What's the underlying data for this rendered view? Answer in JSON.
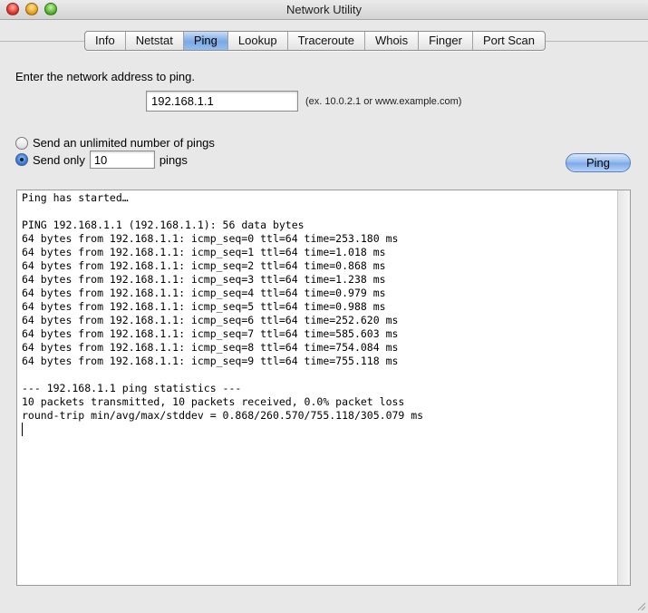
{
  "window": {
    "title": "Network Utility"
  },
  "tabs": [
    {
      "label": "Info",
      "active": false
    },
    {
      "label": "Netstat",
      "active": false
    },
    {
      "label": "Ping",
      "active": true
    },
    {
      "label": "Lookup",
      "active": false
    },
    {
      "label": "Traceroute",
      "active": false
    },
    {
      "label": "Whois",
      "active": false
    },
    {
      "label": "Finger",
      "active": false
    },
    {
      "label": "Port Scan",
      "active": false
    }
  ],
  "ping": {
    "prompt": "Enter the network address to ping.",
    "address_value": "192.168.1.1",
    "address_hint": "(ex. 10.0.2.1 or www.example.com)",
    "option_unlimited_label": "Send an unlimited number of pings",
    "option_limited_prefix": "Send only",
    "option_limited_value": "10",
    "option_limited_suffix": "pings",
    "selected_option": "limited",
    "button_label": "Ping"
  },
  "output": {
    "lines": [
      "Ping has started…",
      "",
      "PING 192.168.1.1 (192.168.1.1): 56 data bytes",
      "64 bytes from 192.168.1.1: icmp_seq=0 ttl=64 time=253.180 ms",
      "64 bytes from 192.168.1.1: icmp_seq=1 ttl=64 time=1.018 ms",
      "64 bytes from 192.168.1.1: icmp_seq=2 ttl=64 time=0.868 ms",
      "64 bytes from 192.168.1.1: icmp_seq=3 ttl=64 time=1.238 ms",
      "64 bytes from 192.168.1.1: icmp_seq=4 ttl=64 time=0.979 ms",
      "64 bytes from 192.168.1.1: icmp_seq=5 ttl=64 time=0.988 ms",
      "64 bytes from 192.168.1.1: icmp_seq=6 ttl=64 time=252.620 ms",
      "64 bytes from 192.168.1.1: icmp_seq=7 ttl=64 time=585.603 ms",
      "64 bytes from 192.168.1.1: icmp_seq=8 ttl=64 time=754.084 ms",
      "64 bytes from 192.168.1.1: icmp_seq=9 ttl=64 time=755.118 ms",
      "",
      "--- 192.168.1.1 ping statistics ---",
      "10 packets transmitted, 10 packets received, 0.0% packet loss",
      "round-trip min/avg/max/stddev = 0.868/260.570/755.118/305.079 ms"
    ]
  },
  "colors": {
    "active_tab": "#79a9e5",
    "button": "#7aa7e8",
    "window_bg": "#e8e8e8"
  }
}
